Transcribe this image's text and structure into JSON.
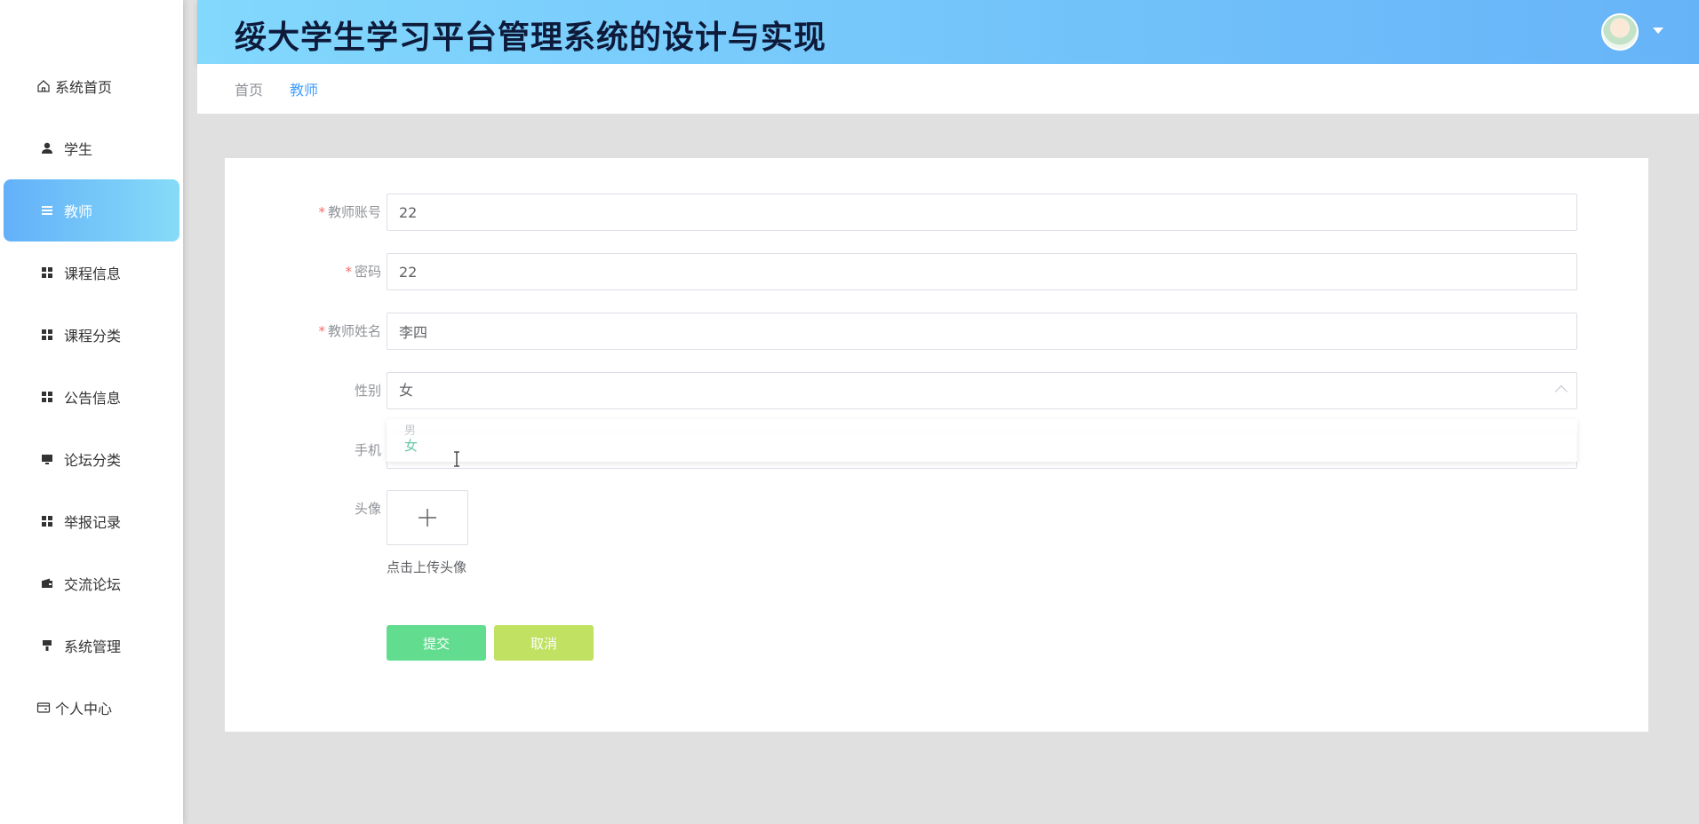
{
  "header": {
    "title": "绥大学生学习平台管理系统的设计与实现"
  },
  "breadcrumb": {
    "home": "首页",
    "current": "教师"
  },
  "sidebar": {
    "items": [
      {
        "label": "系统首页",
        "icon": "home-icon"
      },
      {
        "label": "学生",
        "icon": "user-icon"
      },
      {
        "label": "教师",
        "icon": "list-icon",
        "active": true
      },
      {
        "label": "课程信息",
        "icon": "grid-icon"
      },
      {
        "label": "课程分类",
        "icon": "grid-icon"
      },
      {
        "label": "公告信息",
        "icon": "grid-icon"
      },
      {
        "label": "论坛分类",
        "icon": "monitor-icon"
      },
      {
        "label": "举报记录",
        "icon": "grid-icon"
      },
      {
        "label": "交流论坛",
        "icon": "wallet-icon"
      },
      {
        "label": "系统管理",
        "icon": "brush-icon"
      },
      {
        "label": "个人中心",
        "icon": "card-icon"
      }
    ]
  },
  "form": {
    "account": {
      "label": "教师账号",
      "value": "22"
    },
    "password": {
      "label": "密码",
      "value": "22"
    },
    "name": {
      "label": "教师姓名",
      "value": "李四"
    },
    "gender": {
      "label": "性别",
      "value": "女",
      "options": [
        "男",
        "女"
      ]
    },
    "phone": {
      "label": "手机",
      "value": ""
    },
    "avatar": {
      "label": "头像",
      "hint": "点击上传头像"
    },
    "required_mark": "*",
    "submit_label": "提交",
    "cancel_label": "取消"
  },
  "colors": {
    "sidebar_active_start": "#63b0f9",
    "sidebar_active_end": "#86dbf8",
    "header_start": "#82d8fd",
    "header_end": "#67b3f8",
    "submit": "#62dc8f",
    "cancel": "#c1e163",
    "breadcrumb_active": "#409eff",
    "required": "#f56c6c"
  }
}
